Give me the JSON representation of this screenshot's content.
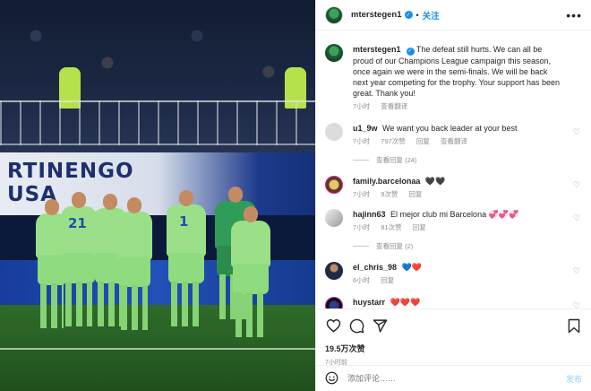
{
  "header": {
    "username": "mterstegen1",
    "separator": "•",
    "follow_label": "关注",
    "more_label": "•••"
  },
  "photo": {
    "board_text_line1": "RTINENGO",
    "board_text_line2": "USA"
  },
  "caption": {
    "username": "mterstegen1",
    "text": "The defeat still hurts. We can all be proud of our Champions League campaign this season, once again we were in the semi-finals. We will be back next year competing for the trophy. Your support has been great. Thank you!",
    "time": "7小时",
    "translate": "查看翻译"
  },
  "comments": [
    {
      "username": "u1_9w",
      "text": "We want you back leader at your best",
      "time": "7小时",
      "likes": "797次赞",
      "reply": "回复",
      "translate": "查看翻译",
      "replies_label": "查看回复 (24)"
    },
    {
      "username": "family.barcelonaa",
      "text": "🖤🖤",
      "time": "7小时",
      "likes": "9次赞",
      "reply": "回复"
    },
    {
      "username": "hajinn63",
      "text": "El mejor club mi Barcelona 💞💞💞",
      "time": "7小时",
      "likes": "81次赞",
      "reply": "回复",
      "replies_label": "查看回复 (2)"
    },
    {
      "username": "el_chris_98",
      "text": "💙❤️",
      "time": "6小时",
      "reply": "回复"
    },
    {
      "username": "huystarr",
      "text": "❤️❤️❤️",
      "time": ""
    }
  ],
  "actions": {
    "likes": "19.5万次赞",
    "time": "7小时前"
  },
  "comment_bar": {
    "placeholder": "添加评论……",
    "post_label": "发布"
  },
  "colors": {
    "accent": "#1a8cf0",
    "muted": "#8e8e8e",
    "kit": "#9be089"
  }
}
